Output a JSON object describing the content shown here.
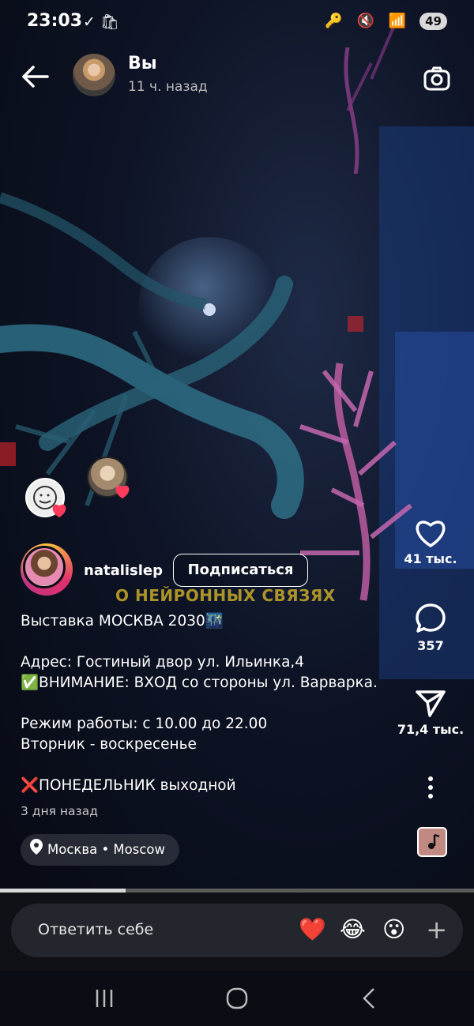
{
  "status_bar": {
    "time": "23:03",
    "left_icons": "✓ 🛍",
    "right_icons": "🔑 🔇 📶",
    "battery": "49"
  },
  "header": {
    "title": "Вы",
    "subtitle": "11 ч. назад",
    "back_icon": "arrow-left-icon",
    "camera_icon": "camera-icon"
  },
  "post": {
    "username": "natalislep",
    "follow_label": "Подписаться",
    "overlay_text": "О НЕЙРОННЫХ СВЯЗЯХ",
    "caption": {
      "line1": "Выставка МОСКВА 2030🌃",
      "line2": "Адрес: Гостиный двор ул. Ильинка,4",
      "line3_mark": "✅",
      "line3": "ВНИМАНИЕ: ВХОД со стороны ул. Варварка.",
      "line4": "Режим работы: с 10.00 до 22.00",
      "line5": "Вторник - воскресенье",
      "line6_mark": "❌",
      "line6": "ПОНЕДЕЛЬНИК выходной"
    },
    "age": "3 дня назад",
    "location": "Москва • Moscow"
  },
  "actions": {
    "likes": "41 тыс.",
    "comments": "357",
    "shares": "71,4 тыс."
  },
  "progress": {
    "fraction": 0.265
  },
  "reply": {
    "placeholder": "Ответить себе",
    "emojis": [
      "❤️",
      "😂",
      "😮"
    ],
    "plus": "+"
  },
  "colors": {
    "accent_heart": "#ff3040",
    "background": "#0b0d14"
  }
}
